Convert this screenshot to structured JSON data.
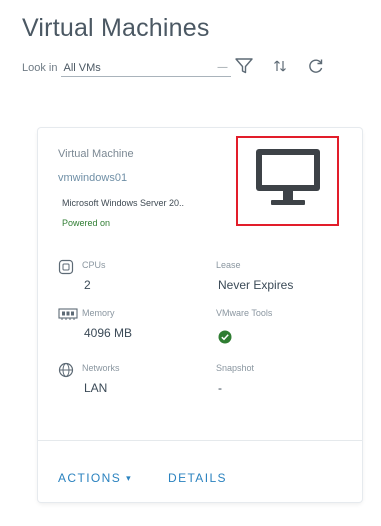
{
  "page": {
    "title": "Virtual Machines"
  },
  "filter": {
    "look_in_label": "Look in",
    "look_in_value": "All VMs"
  },
  "toolbar": {
    "filter_icon": "filter-icon",
    "sort_icon": "sort-icon",
    "refresh_icon": "refresh-icon"
  },
  "card": {
    "header_label": "Virtual Machine",
    "vm_name": "vmwindows01",
    "os": "Microsoft Windows Server 20..",
    "power_state": "Powered on",
    "monitor_icon": "monitor-icon",
    "cpus": {
      "label": "CPUs",
      "value": "2"
    },
    "lease": {
      "label": "Lease",
      "value": "Never Expires"
    },
    "memory": {
      "label": "Memory",
      "value": "4096 MB"
    },
    "vmware_tools": {
      "label": "VMware Tools"
    },
    "networks": {
      "label": "Networks",
      "value": "LAN"
    },
    "snapshot": {
      "label": "Snapshot",
      "value": "-"
    },
    "actions_label": "ACTIONS",
    "details_label": "DETAILS"
  },
  "colors": {
    "highlight_border": "#e21d2a",
    "link": "#2a82bf",
    "status_green": "#2f7d32"
  }
}
